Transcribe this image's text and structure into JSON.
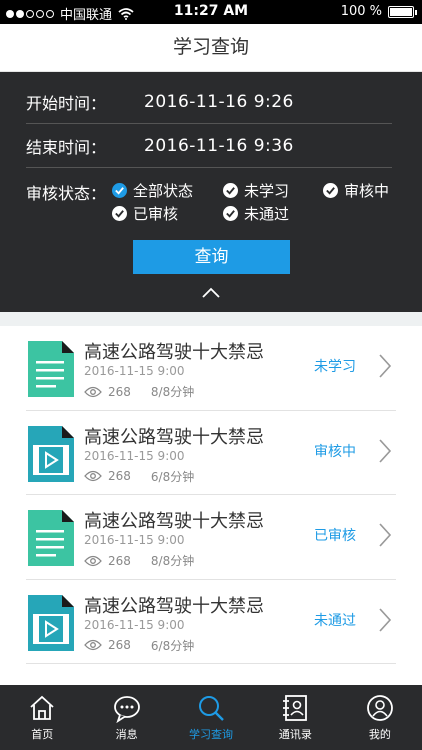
{
  "status_bar": {
    "carrier": "中国联通",
    "time": "11:27 AM",
    "battery": "100 %",
    "battery_level": 1.0
  },
  "nav": {
    "title": "学习查询"
  },
  "filter": {
    "start_label": "开始时间：",
    "start_value": "2016-11-16  9:26",
    "end_label": "结束时间：",
    "end_value": "2016-11-16  9:36",
    "status_label": "审核状态：",
    "options": [
      "全部状态",
      "未学习",
      "审核中",
      "已审核",
      "未通过"
    ],
    "selected_option": "全部状态",
    "query_button": "查询"
  },
  "records": [
    {
      "title": "高速公路驾驶十大禁忌",
      "date": "2016-11-15  9:00",
      "views": "268",
      "duration": "8/8分钟",
      "status": "未学习",
      "type": "document"
    },
    {
      "title": "高速公路驾驶十大禁忌",
      "date": "2016-11-15  9:00",
      "views": "268",
      "duration": "6/8分钟",
      "status": "审核中",
      "type": "video"
    },
    {
      "title": "高速公路驾驶十大禁忌",
      "date": "2016-11-15  9:00",
      "views": "268",
      "duration": "8/8分钟",
      "status": "已审核",
      "type": "document"
    },
    {
      "title": "高速公路驾驶十大禁忌",
      "date": "2016-11-15  9:00",
      "views": "268",
      "duration": "6/8分钟",
      "status": "未通过",
      "type": "video"
    }
  ],
  "tabs": [
    {
      "label": "首页",
      "icon": "home-icon"
    },
    {
      "label": "消息",
      "icon": "message-icon"
    },
    {
      "label": "学习查询",
      "icon": "search-icon",
      "active": true
    },
    {
      "label": "通讯录",
      "icon": "contacts-icon"
    },
    {
      "label": "我的",
      "icon": "profile-icon"
    }
  ],
  "colors": {
    "accent": "#1e9be5",
    "panel": "#2a2b2d",
    "doc_icon": "#3cc4a2",
    "video_icon": "#26a6b8"
  }
}
